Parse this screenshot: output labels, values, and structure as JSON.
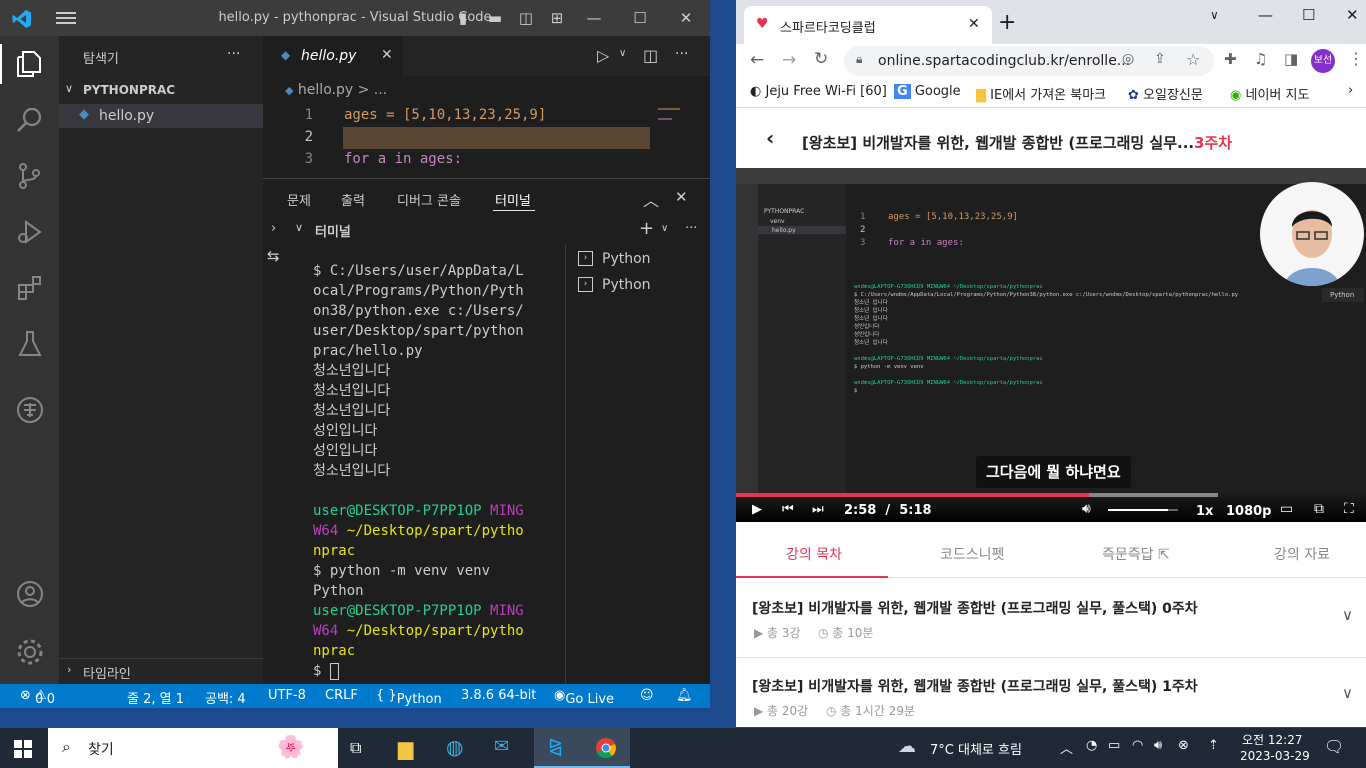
{
  "vscode": {
    "title": "hello.py - pythonprac - Visual Studio Code",
    "sidebar": {
      "title": "탐색기",
      "more": "···",
      "folder": "PYTHONPRAC",
      "file": "hello.py",
      "timeline": "타임라인"
    },
    "tab": {
      "name": "hello.py",
      "close": "✕"
    },
    "breadcrumb": "hello.py > ...",
    "code": [
      {
        "num": "1",
        "text": "ages = [5,10,13,23,25,9]"
      },
      {
        "num": "2",
        "text": ""
      },
      {
        "num": "3",
        "text": "for a in ages:"
      }
    ],
    "panel_tabs": [
      "문제",
      "출력",
      "디버그 콘솔",
      "터미널"
    ],
    "terminal_header": "터미널",
    "terminal_list": [
      "Python",
      "Python"
    ],
    "terminal_lines": [
      {
        "text": "$ C:/Users/user/AppData/L",
        "color": "#cccccc"
      },
      {
        "text": "ocal/Programs/Python/Pyth",
        "color": "#cccccc"
      },
      {
        "text": "on38/python.exe c:/Users/",
        "color": "#cccccc"
      },
      {
        "text": "user/Desktop/spart/python",
        "color": "#cccccc"
      },
      {
        "text": "prac/hello.py",
        "color": "#cccccc"
      },
      {
        "text": "청소년입니다",
        "color": "#cccccc"
      },
      {
        "text": "청소년입니다",
        "color": "#cccccc"
      },
      {
        "text": "청소년입니다",
        "color": "#cccccc"
      },
      {
        "text": "성인입니다",
        "color": "#cccccc"
      },
      {
        "text": "성인입니다",
        "color": "#cccccc"
      },
      {
        "text": "청소년입니다",
        "color": "#cccccc"
      },
      {
        "text": "",
        "color": "#cccccc"
      },
      {
        "text": "user@DESKTOP-P7PP1OP MING",
        "color": "#23d18b",
        "accent": "MING"
      },
      {
        "text": "W64 ~/Desktop/spart/pytho",
        "color": "#e5e510",
        "accent": "W64"
      },
      {
        "text": "nprac",
        "color": "#e5e510"
      },
      {
        "text": "$ python -m venv venv",
        "color": "#cccccc"
      },
      {
        "text": "Python",
        "color": "#cccccc"
      },
      {
        "text": "user@DESKTOP-P7PP1OP MING",
        "color": "#23d18b",
        "accent": "MING"
      },
      {
        "text": "W64 ~/Desktop/spart/pytho",
        "color": "#e5e510",
        "accent": "W64"
      },
      {
        "text": "nprac",
        "color": "#e5e510"
      },
      {
        "text": "$ ",
        "color": "#cccccc",
        "cursor": true
      }
    ],
    "status": {
      "errors": "0",
      "warnings": "0",
      "position": "줄 2, 열 1",
      "spaces": "공백: 4",
      "encoding": "UTF-8",
      "eol": "CRLF",
      "language": "Python",
      "interpreter": "3.8.6 64-bit",
      "golive": "Go Live"
    }
  },
  "chrome": {
    "tab_title": "스파르타코딩클럽",
    "url": "online.spartacodingclub.kr/enrolle...",
    "profile": "보선",
    "bookmarks": [
      "Jeju Free Wi-Fi [60]",
      "Google",
      "IE에서 가져온 북마크",
      "오일장신문",
      "네이버 지도"
    ],
    "course_title": "[왕초보] 비개발자를 위한, 웹개발 종합반 (프로그래밍 실무...",
    "week": "3주차",
    "video": {
      "subtitle": "그다음에 뭘 하냐면요",
      "current": "2:58",
      "separator": "/",
      "duration": "5:18",
      "speed": "1x",
      "quality": "1080p",
      "progress": 0.56,
      "volume": 0.85,
      "code_lines": [
        {
          "num": "1",
          "text": "ages = [5,10,13,23,25,9]"
        },
        {
          "num": "2",
          "text": ""
        },
        {
          "num": "3",
          "text": "for a in ages:"
        }
      ],
      "term_lines": [
        "wndms@LAPTOP-G736HCD9 MINGW64 ~/Desktop/sparta/pythonprac",
        "$ C:/Users/wndms/AppData/Local/Programs/Python/Python38/python.exe c:/Users/wndms/Desktop/sparta/pythonprac/hello.py",
        "청소년 입니다",
        "청소년 입니다",
        "청소년 입니다",
        "성인입니다",
        "성인입니다",
        "청소년 입니다",
        "",
        "wndms@LAPTOP-G736HCD9 MINGW64 ~/Desktop/sparta/pythonprac",
        "$ python -m venv venv",
        "",
        "wndms@LAPTOP-G736HCD9 MINGW64 ~/Desktop/sparta/pythonprac",
        "$"
      ],
      "mini_file": "hello.py",
      "mini_folder": "PYTHONPRAC",
      "mini_venv": "venv",
      "mini_python": "Python"
    },
    "lecture_tabs": [
      "강의 목차",
      "코드스니펫",
      "즉문즉답",
      "강의 자료"
    ],
    "weeks": [
      {
        "title": "[왕초보] 비개발자를 위한, 웹개발 종합반 (프로그래밍 실무, 풀스택) 0주차",
        "lessons": "총 3강",
        "time": "총 10분"
      },
      {
        "title": "[왕초보] 비개발자를 위한, 웹개발 종합반 (프로그래밍 실무, 풀스택) 1주차",
        "lessons": "총 20강",
        "time": "총 1시간 29분"
      }
    ]
  },
  "taskbar": {
    "search": "찾기",
    "weather": "7°C  대체로 흐림",
    "time": "오전 12:27",
    "date": "2023-03-29"
  },
  "colors": {
    "vs_blue": "#007acc",
    "brand_red": "#e8344e",
    "taskbar": "#1f2a36"
  }
}
